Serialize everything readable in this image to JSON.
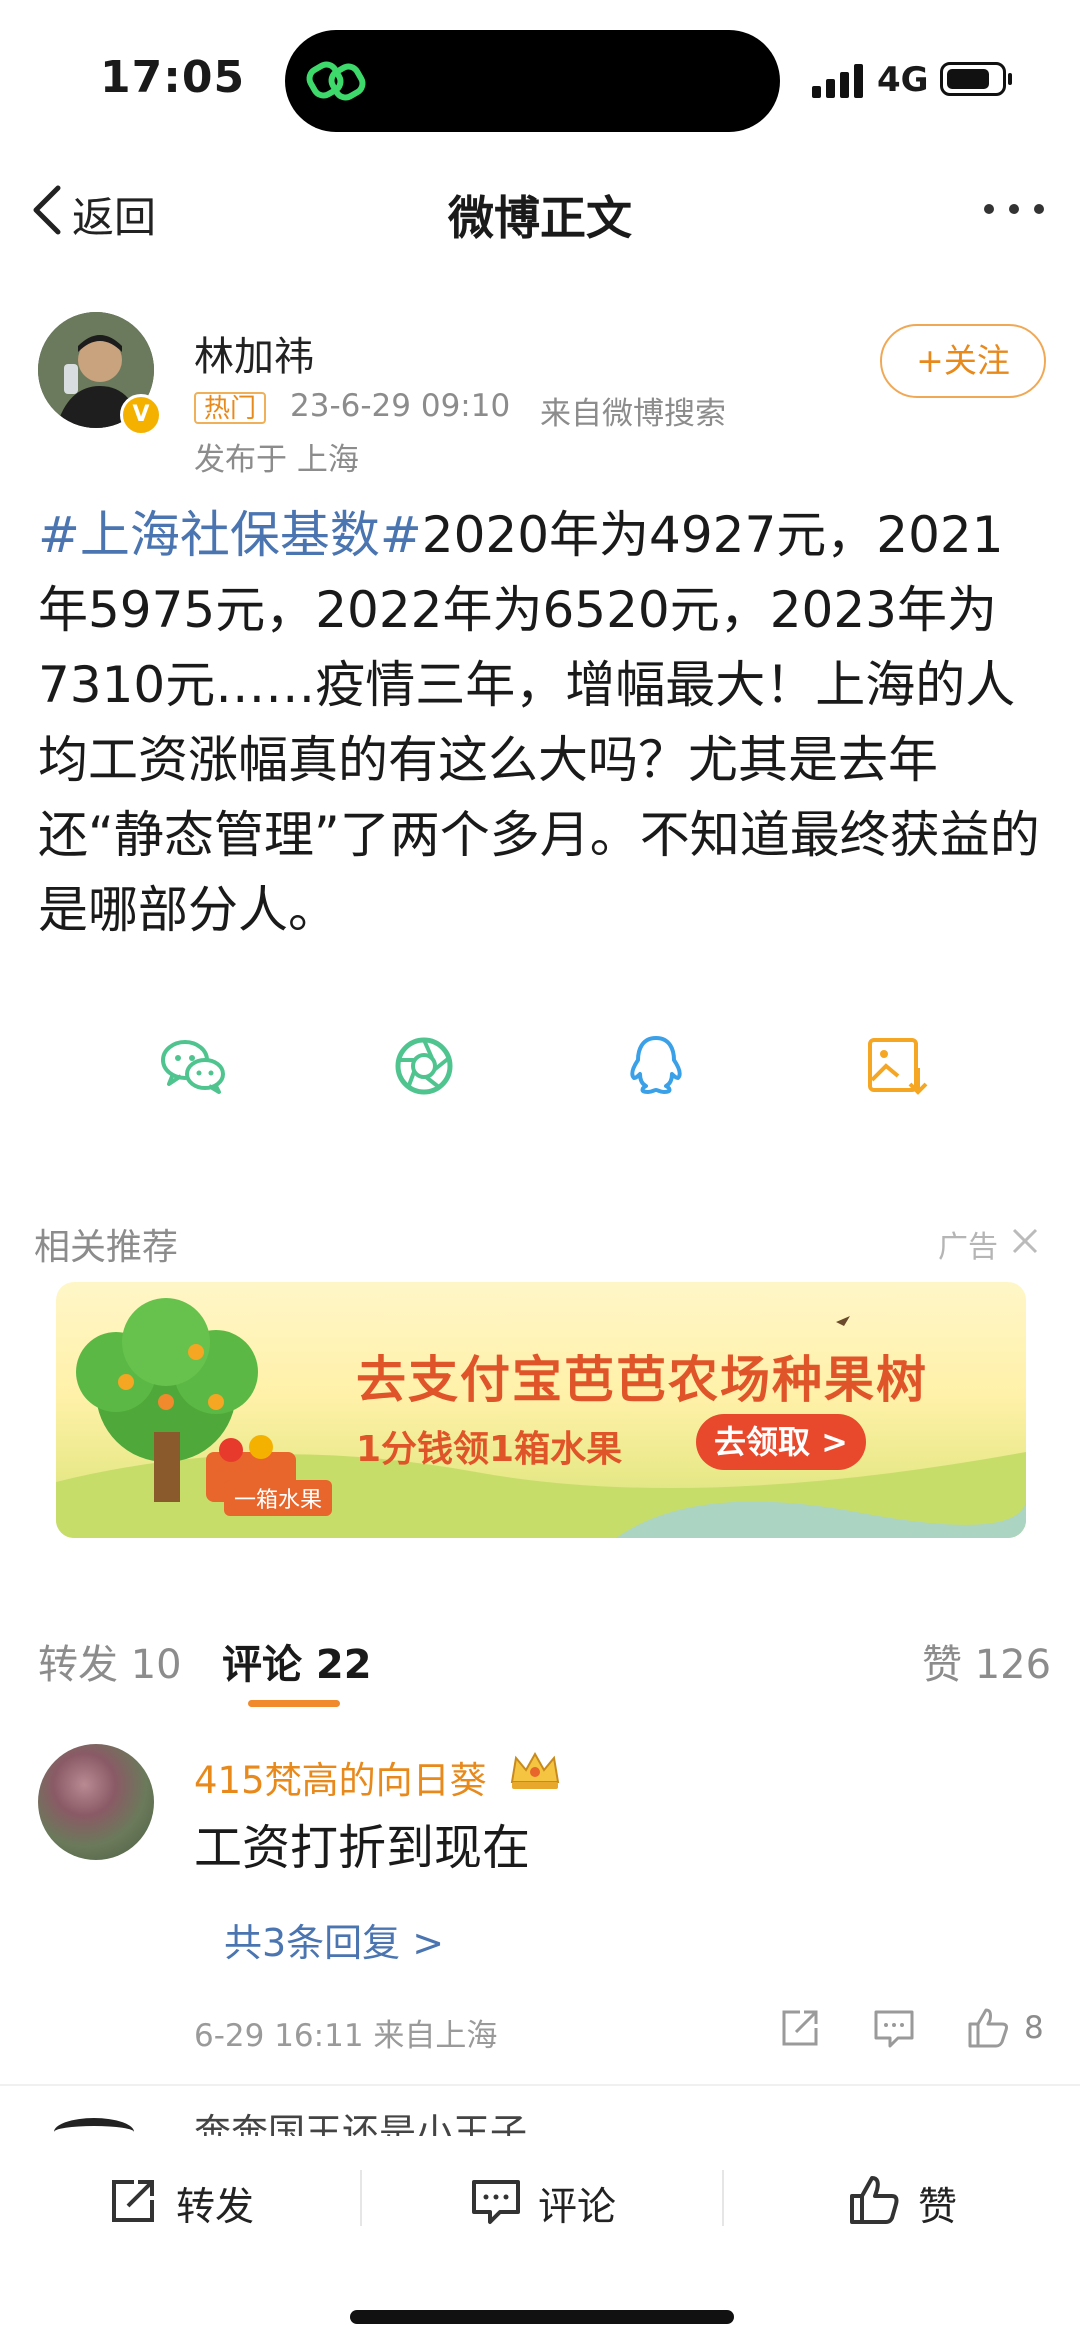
{
  "status_bar": {
    "time": "17:05",
    "network": "4G"
  },
  "nav": {
    "back_label": "返回",
    "title": "微博正文"
  },
  "post": {
    "author": "林加祎",
    "badge": "热门",
    "time": "23-6-29 09:10",
    "source": "来自微博搜索",
    "location": "发布于 上海",
    "follow_label": "+关注",
    "hashtag": "#上海社保基数#",
    "text": "2020年为4927元，2021年5975元，2022年为6520元，2023年为7310元……疫情三年，增幅最大！上海的人均工资涨幅真的有这么大吗？尤其是去年还“静态管理”了两个多月。不知道最终获益的是哪部分人。"
  },
  "share_icons": [
    "wechat-icon",
    "moments-icon",
    "qq-icon",
    "save-image-icon"
  ],
  "related": {
    "title": "相关推荐",
    "ad_label": "广告",
    "banner": {
      "headline": "去支付宝芭芭农场种果树",
      "subline": "1分钱领1箱水果",
      "button": "去领取 >",
      "tag": "一箱水果"
    }
  },
  "tabs": {
    "repost": "转发 10",
    "comments": "评论 22",
    "likes": "赞 126"
  },
  "comments": [
    {
      "user": "415梵高的向日葵",
      "text": "工资打折到现在",
      "replies_link": "共3条回复 >",
      "meta": "6-29 16:11  来自上海",
      "likes": "8"
    }
  ],
  "next_comment_user": "奔奔国王还是小王子",
  "bottom_bar": {
    "repost": "转发",
    "comment": "评论",
    "like": "赞"
  },
  "colors": {
    "link": "#4a75b0",
    "accent": "#f08a2c",
    "username": "#e8891c"
  }
}
